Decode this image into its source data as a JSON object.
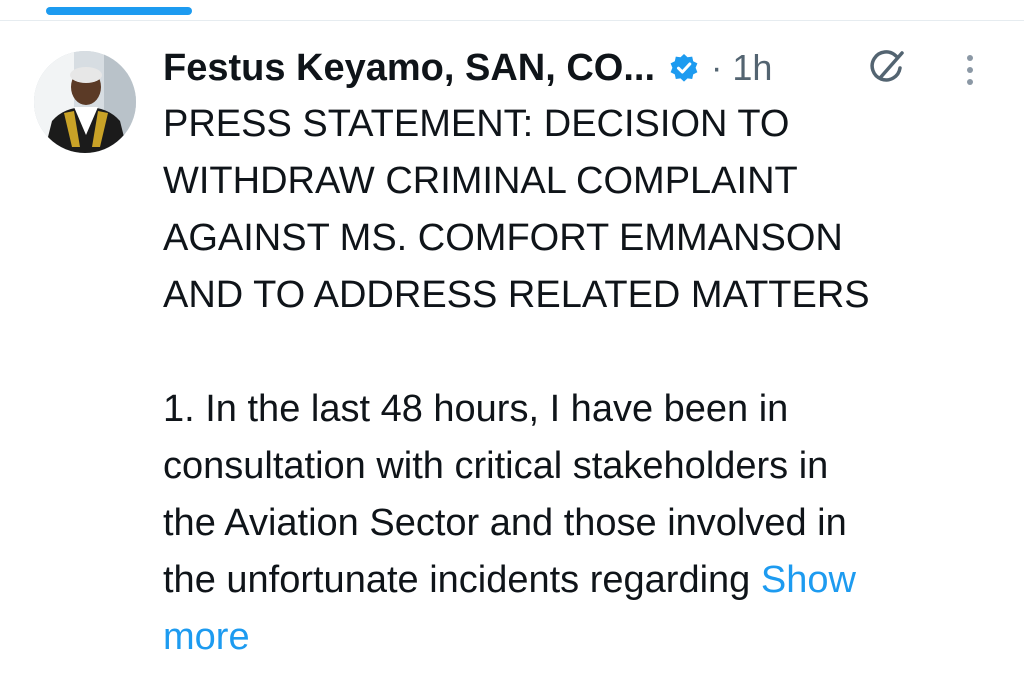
{
  "post": {
    "author_name": "Festus Keyamo, SAN, CO...",
    "separator": "·",
    "time": "1h",
    "title_lines": [
      "PRESS STATEMENT: DECISION TO",
      "WITHDRAW CRIMINAL COMPLAINT",
      "AGAINST MS. COMFORT EMMANSON",
      "AND TO ADDRESS RELATED MATTERS"
    ],
    "body_lines": [
      "1. In the last 48 hours, I have been in",
      "consultation with critical stakeholders in",
      "the Aviation Sector and those involved in",
      "the unfortunate incidents regarding "
    ],
    "show_more_first": "Show",
    "show_more_second": "more"
  },
  "icons": {
    "verified": "verified-badge-icon",
    "grok": "grok-icon",
    "more": "more-options-icon"
  },
  "colors": {
    "accent": "#1d9bf0",
    "text": "#0f1419",
    "muted": "#536471"
  }
}
